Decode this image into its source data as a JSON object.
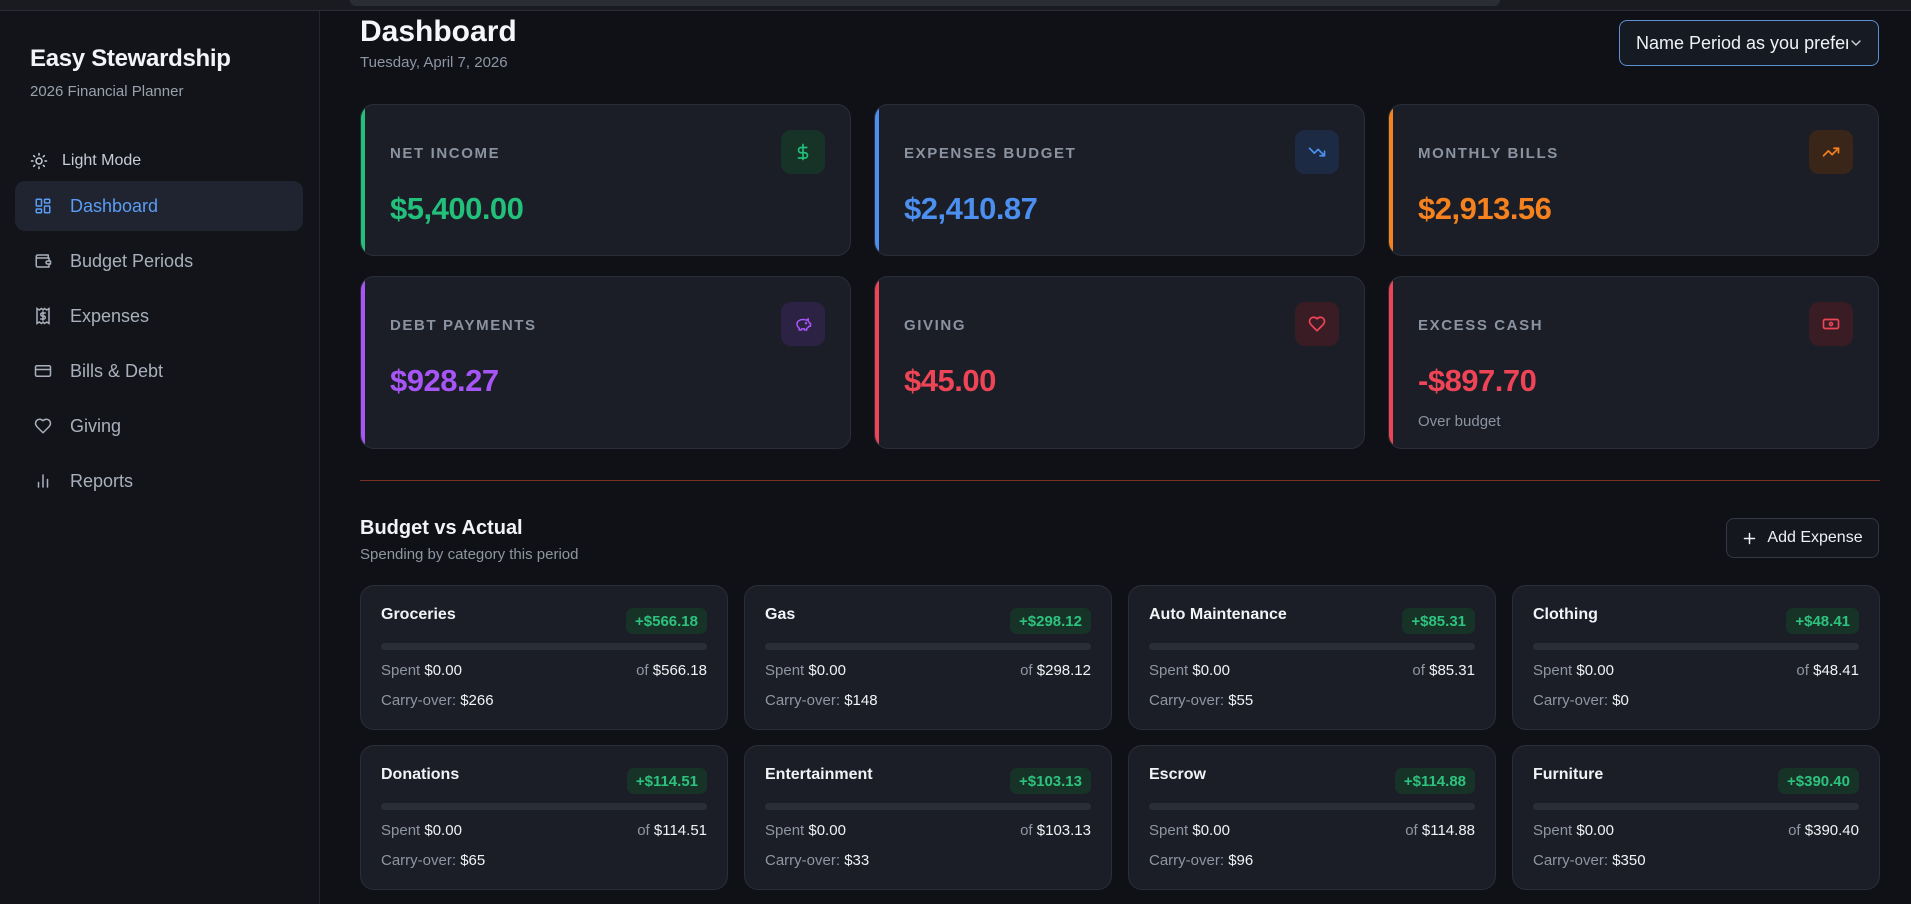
{
  "app": {
    "brand_title": "Easy Stewardship",
    "brand_subtitle": "2026 Financial Planner",
    "mode_toggle_label": "Light Mode"
  },
  "sidebar": {
    "items": [
      {
        "label": "Dashboard",
        "icon": "dashboard-icon",
        "active": true
      },
      {
        "label": "Budget Periods",
        "icon": "wallet-icon",
        "active": false
      },
      {
        "label": "Expenses",
        "icon": "receipt-icon",
        "active": false
      },
      {
        "label": "Bills & Debt",
        "icon": "credit-card-icon",
        "active": false
      },
      {
        "label": "Giving",
        "icon": "heart-icon",
        "active": false
      },
      {
        "label": "Reports",
        "icon": "bar-chart-icon",
        "active": false
      }
    ]
  },
  "header": {
    "title": "Dashboard",
    "date": "Tuesday, April 7, 2026",
    "period_select_value": "Name Period as you prefer"
  },
  "stats": [
    {
      "label": "NET INCOME",
      "value": "$5,400.00",
      "color": "#22c07a",
      "icon": "dollar-icon",
      "note": ""
    },
    {
      "label": "EXPENSES BUDGET",
      "value": "$2,410.87",
      "color": "#4b8ff0",
      "icon": "trending-down-icon",
      "note": ""
    },
    {
      "label": "MONTHLY BILLS",
      "value": "$2,913.56",
      "color": "#f5821f",
      "icon": "trending-up-icon",
      "note": ""
    },
    {
      "label": "DEBT PAYMENTS",
      "value": "$928.27",
      "color": "#a855f7",
      "icon": "piggy-bank-icon",
      "note": ""
    },
    {
      "label": "GIVING",
      "value": "$45.00",
      "color": "#ef4456",
      "icon": "heart-icon",
      "note": ""
    },
    {
      "label": "EXCESS CASH",
      "value": "-$897.70",
      "color": "#ef4456",
      "icon": "banknote-icon",
      "note": "Over budget"
    }
  ],
  "budget_section": {
    "title": "Budget vs Actual",
    "subtitle": "Spending by category this period",
    "add_button_label": "Add Expense"
  },
  "labels": {
    "spent": "Spent",
    "of": "of",
    "carry_over": "Carry-over:"
  },
  "categories": [
    {
      "name": "Groceries",
      "badge": "+$566.18",
      "spent": "$0.00",
      "total": "$566.18",
      "carry": "$266"
    },
    {
      "name": "Gas",
      "badge": "+$298.12",
      "spent": "$0.00",
      "total": "$298.12",
      "carry": "$148"
    },
    {
      "name": "Auto Maintenance",
      "badge": "+$85.31",
      "spent": "$0.00",
      "total": "$85.31",
      "carry": "$55"
    },
    {
      "name": "Clothing",
      "badge": "+$48.41",
      "spent": "$0.00",
      "total": "$48.41",
      "carry": "$0"
    },
    {
      "name": "Donations",
      "badge": "+$114.51",
      "spent": "$0.00",
      "total": "$114.51",
      "carry": "$65"
    },
    {
      "name": "Entertainment",
      "badge": "+$103.13",
      "spent": "$0.00",
      "total": "$103.13",
      "carry": "$33"
    },
    {
      "name": "Escrow",
      "badge": "+$114.88",
      "spent": "$0.00",
      "total": "$114.88",
      "carry": "$96"
    },
    {
      "name": "Furniture",
      "badge": "+$390.40",
      "spent": "$0.00",
      "total": "$390.40",
      "carry": "$350"
    }
  ]
}
